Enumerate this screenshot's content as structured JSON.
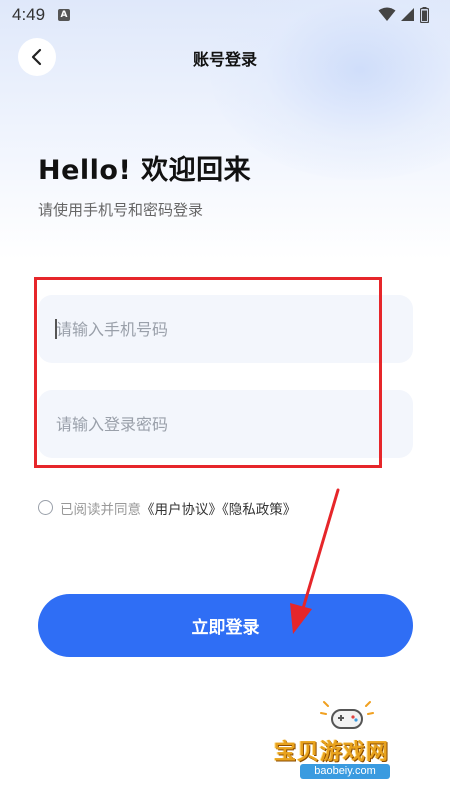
{
  "status_bar": {
    "time": "4:49",
    "app_icon_letter": "A"
  },
  "header": {
    "title": "账号登录"
  },
  "greeting": {
    "title": "Hello! 欢迎回来",
    "subtitle": "请使用手机号和密码登录"
  },
  "form": {
    "phone_placeholder": "请输入手机号码",
    "phone_value": "",
    "password_placeholder": "请输入登录密码",
    "password_value": ""
  },
  "agreement": {
    "checked": false,
    "prefix": "已阅读并同意",
    "user_agreement": "《用户协议》",
    "privacy_policy": "《隐私政策》"
  },
  "login_button": {
    "label": "立即登录"
  },
  "watermark": {
    "name": "宝贝游戏网",
    "url": "baobeiy.com"
  },
  "colors": {
    "primary": "#2f6ef5",
    "annotation": "#e6262a"
  }
}
